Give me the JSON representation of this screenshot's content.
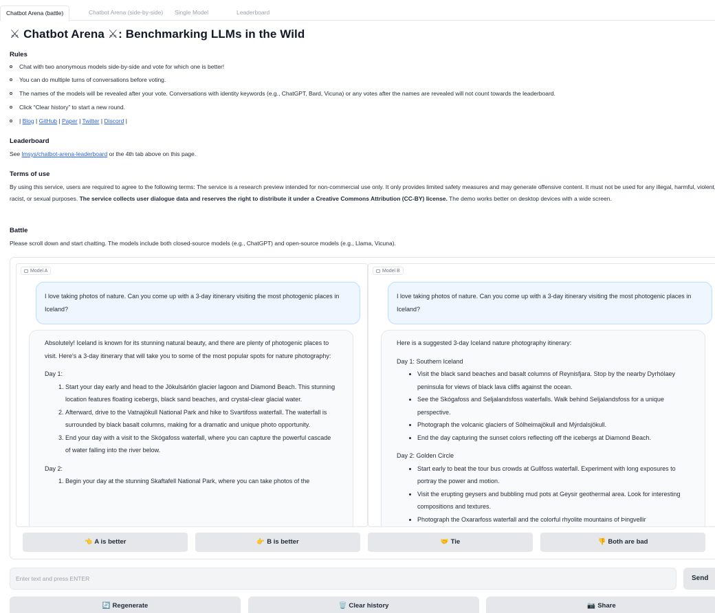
{
  "tabs": [
    {
      "label": "Chatbot Arena (battle)"
    },
    {
      "label": "Chatbot Arena (side-by-side)"
    },
    {
      "label": "Single Model"
    },
    {
      "label": "Leaderboard"
    }
  ],
  "page": {
    "title_icon": "⚔",
    "title": "Chatbot Arena",
    "title_suffix": ": Benchmarking LLMs in the Wild"
  },
  "rules": {
    "heading": "Rules",
    "items": [
      "Chat with two anonymous models side-by-side and vote for which one is better!",
      "You can do multiple turns of conversations before voting.",
      "The names of the models will be revealed after your vote. Conversations with identity keywords (e.g., ChatGPT, Bard, Vicuna) or any votes after the names are revealed will not count towards the leaderboard.",
      "Click “Clear history” to start a new round."
    ],
    "links_prefix": "|",
    "links": [
      "Blog",
      "GitHub",
      "Paper",
      "Twitter",
      "Discord"
    ],
    "separator": "|"
  },
  "leaderboard": {
    "heading": "Leaderboard",
    "prefix": "See ",
    "link": "lmsys/chatbot-arena-leaderboard",
    "suffix": " or the 4th tab above on this page."
  },
  "terms": {
    "heading": "Terms of use",
    "text_1": "By using this service, users are required to agree to the following terms: The service is a research preview intended for non-commercial use only. It only provides limited safety measures and may generate offensive content. It must not be used for any illegal, harmful, violent, racist, or sexual purposes. ",
    "bold": "The service collects user dialogue data and reserves the right to distribute it under a Creative Commons Attribution (CC-BY) license.",
    "text_2": " The demo works better on desktop devices with a wide screen."
  },
  "battle": {
    "heading": "Battle",
    "text": "Please scroll down and start chatting. The models include both closed-source models (e.g., ChatGPT) and open-source models (e.g., Llama, Vicuna)."
  },
  "model_a": {
    "label": "Model A",
    "user_message": "I love taking photos of nature. Can you come up with a 3-day itinerary visiting the most photogenic places in Iceland?",
    "intro": "Absolutely! Iceland is known for its stunning natural beauty, and there are plenty of photogenic places to visit. Here's a 3-day itinerary that will take you to some of the most popular spots for nature photography:",
    "day1_title": "Day 1:",
    "day1_items": [
      "Start your day early and head to the Jökulsárlón glacier lagoon and Diamond Beach. This stunning location features floating icebergs, black sand beaches, and crystal-clear glacial water.",
      "Afterward, drive to the Vatnajökull National Park and hike to Svartifoss waterfall. The waterfall is surrounded by black basalt columns, making for a dramatic and unique photo opportunity.",
      "End your day with a visit to the Skógafoss waterfall, where you can capture the powerful cascade of water falling into the river below."
    ],
    "day2_title": "Day 2:",
    "day2_items": [
      "Begin your day at the stunning Skaftafell National Park, where you can take photos of the"
    ]
  },
  "model_b": {
    "label": "Model B",
    "user_message": "I love taking photos of nature. Can you come up with a 3-day itinerary visiting the most photogenic places in Iceland?",
    "intro": "Here is a suggested 3-day Iceland nature photography itinerary:",
    "day1_title": "Day 1: Southern Iceland",
    "day1_items": [
      "Visit the black sand beaches and basalt columns of Reynisfjara. Stop by the nearby Dyrhólaey peninsula for views of black lava cliffs against the ocean.",
      "See the Skógafoss and Seljalandsfoss waterfalls. Walk behind Seljalandsfoss for a unique perspective.",
      "Photograph the volcanic glaciers of Sólheimajökull and Mýrdalsjökull.",
      "End the day capturing the sunset colors reflecting off the icebergs at Diamond Beach."
    ],
    "day2_title": "Day 2: Golden Circle",
    "day2_items": [
      "Start early to beat the tour bus crowds at Gullfoss waterfall. Experiment with long exposures to portray the power and motion.",
      "Visit the erupting geysers and bubbling mud pots at Geysir geothermal area. Look for interesting compositions and textures.",
      "Photograph the Oxararfoss waterfall and the colorful rhyolite mountains of Þingvellir"
    ]
  },
  "votes": [
    {
      "emoji": "👈",
      "label": "A is better"
    },
    {
      "emoji": "👉",
      "label": "B is better"
    },
    {
      "emoji": "🤝",
      "label": "Tie"
    },
    {
      "emoji": "👎",
      "label": "Both are bad"
    }
  ],
  "input": {
    "placeholder": "Enter text and press ENTER",
    "value": "",
    "send_label": "Send"
  },
  "actions": [
    {
      "icon": "🔄",
      "label": "Regenerate"
    },
    {
      "icon": "🗑️",
      "label": "Clear history"
    },
    {
      "icon": "📷",
      "label": "Share"
    }
  ],
  "colors": {
    "link": "#2563eb",
    "user_bubble": "#eff6ff",
    "bot_bubble": "#f9fafb",
    "button_bg": "#e5e7eb"
  }
}
